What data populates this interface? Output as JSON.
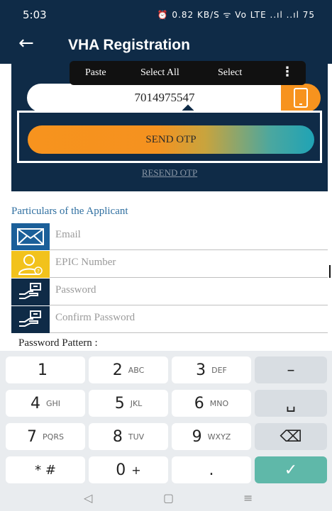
{
  "status": {
    "time": "5:03",
    "icons": "⏰ 0.82 KB/S ᯤ Vo LTE ..ıl ..ıl 75"
  },
  "appbar": {
    "back_glyph": "←",
    "title": "VHA Registration"
  },
  "context_menu": {
    "paste": "Paste",
    "select_all": "Select All",
    "select": "Select",
    "more": "⋮"
  },
  "phone": {
    "value": "7014975547"
  },
  "otp": {
    "send_label": "SEND OTP",
    "resend_label": "RESEND OTP"
  },
  "form": {
    "section_title": "Particulars of the Applicant",
    "fields": [
      {
        "placeholder": "Email",
        "icon": "envelope-icon"
      },
      {
        "placeholder": "EPIC Number",
        "icon": "user-id-icon"
      },
      {
        "placeholder": "Password",
        "icon": "hand-key-icon"
      },
      {
        "placeholder": "Confirm Password",
        "icon": "hand-key-icon"
      }
    ],
    "password_pattern_label": "Password Pattern :"
  },
  "keyboard": {
    "rows": [
      [
        {
          "main": "1",
          "sub": ""
        },
        {
          "main": "2",
          "sub": "ABC"
        },
        {
          "main": "3",
          "sub": "DEF"
        },
        {
          "main": "–",
          "sub": ""
        }
      ],
      [
        {
          "main": "4",
          "sub": "GHI"
        },
        {
          "main": "5",
          "sub": "JKL"
        },
        {
          "main": "6",
          "sub": "MNO"
        },
        {
          "main": "␣",
          "sub": ""
        }
      ],
      [
        {
          "main": "7",
          "sub": "PQRS"
        },
        {
          "main": "8",
          "sub": "TUV"
        },
        {
          "main": "9",
          "sub": "WXYZ"
        },
        {
          "main": "⌫",
          "sub": ""
        }
      ],
      [
        {
          "main": "* #",
          "sub": ""
        },
        {
          "main": "0",
          "sub": "+"
        },
        {
          "main": ".",
          "sub": ""
        },
        {
          "main": "✓",
          "sub": ""
        }
      ]
    ]
  },
  "navbar": {
    "back": "◁",
    "home": "▢",
    "recents": "≡"
  },
  "colors": {
    "header": "#0f2b47",
    "accent_orange": "#f7931e",
    "accent_teal": "#1fa3b5",
    "email_icon_bg": "#1b5f99",
    "epic_icon_bg": "#f2c21c",
    "done_key": "#5fb8a9"
  }
}
